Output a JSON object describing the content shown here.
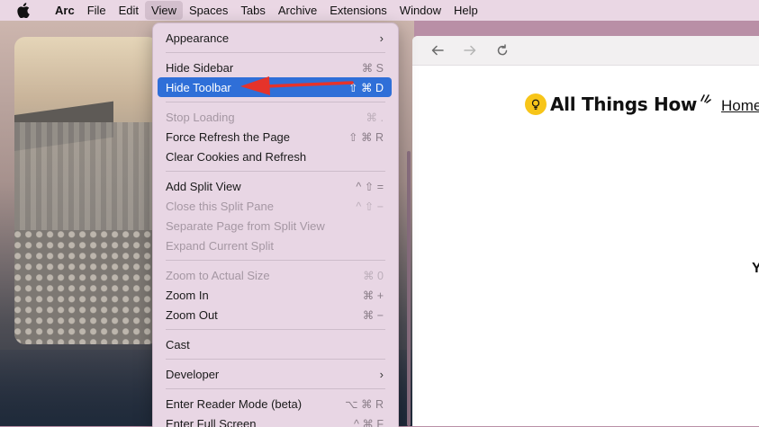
{
  "menubar": {
    "app": "Arc",
    "items": [
      "File",
      "Edit",
      "View",
      "Spaces",
      "Tabs",
      "Archive",
      "Extensions",
      "Window",
      "Help"
    ],
    "active": "View"
  },
  "browser": {
    "site_name": "All Things How",
    "nav_home": "Home",
    "edge_glyph": "Y"
  },
  "view_menu": {
    "appearance": "Appearance",
    "hide_sidebar": {
      "label": "Hide Sidebar",
      "shortcut": "⌘ S"
    },
    "hide_toolbar": {
      "label": "Hide Toolbar",
      "shortcut": "⇧ ⌘ D"
    },
    "stop_loading": {
      "label": "Stop Loading",
      "shortcut": "⌘ ."
    },
    "force_refresh": {
      "label": "Force Refresh the Page",
      "shortcut": "⇧ ⌘ R"
    },
    "clear_cookies": {
      "label": "Clear Cookies and Refresh"
    },
    "add_split": {
      "label": "Add Split View",
      "shortcut": "^ ⇧ ="
    },
    "close_split": {
      "label": "Close this Split Pane",
      "shortcut": "^ ⇧ −"
    },
    "separate_page": {
      "label": "Separate Page from Split View"
    },
    "expand_split": {
      "label": "Expand Current Split"
    },
    "zoom_actual": {
      "label": "Zoom to Actual Size",
      "shortcut": "⌘ 0"
    },
    "zoom_in": {
      "label": "Zoom In",
      "shortcut": "⌘ +"
    },
    "zoom_out": {
      "label": "Zoom Out",
      "shortcut": "⌘ −"
    },
    "cast": {
      "label": "Cast"
    },
    "developer": {
      "label": "Developer"
    },
    "reader_mode": {
      "label": "Enter Reader Mode (beta)",
      "shortcut": "⌥ ⌘ R"
    },
    "full_screen": {
      "label": "Enter Full Screen",
      "shortcut": "^ ⌘ F"
    }
  },
  "colors": {
    "highlight": "#2f6fd8",
    "annotation": "#e5332a"
  }
}
